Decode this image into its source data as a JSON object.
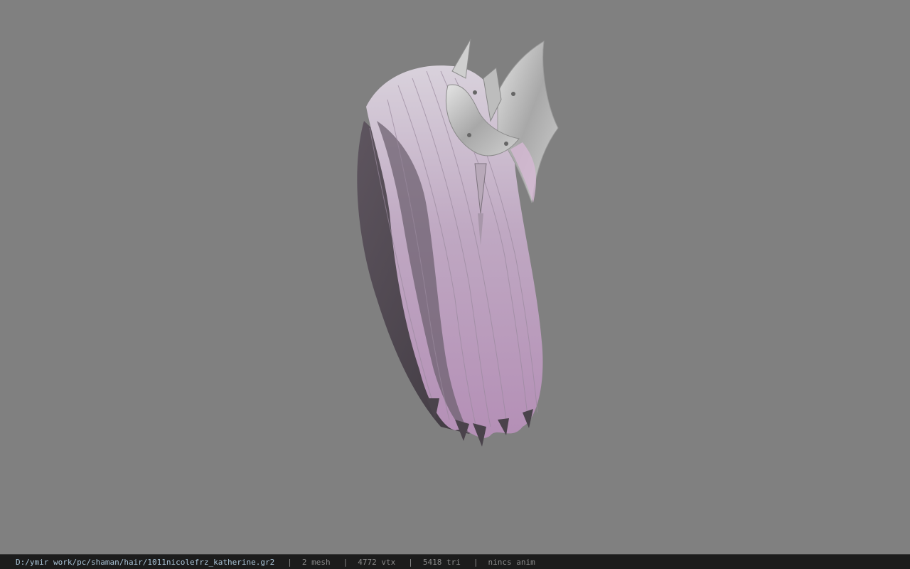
{
  "viewport": {
    "background": "#808080",
    "model": "hair-mesh-render"
  },
  "statusbar": {
    "path": "D:/ymir work/pc/shaman/hair/1011nicolefrz_katherine.gr2",
    "separator": "|",
    "mesh": "2 mesh",
    "vtx": "4772 vtx",
    "tri": "5418 tri",
    "anim": "nincs anim"
  }
}
